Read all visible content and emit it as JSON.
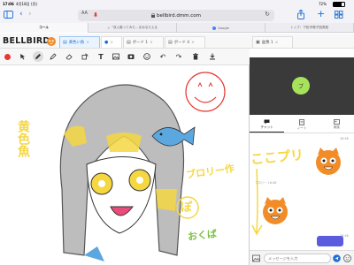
{
  "status_bar": {
    "time": "17:06",
    "date": "4月18日 (月)",
    "battery": "72%"
  },
  "browser": {
    "url": "bellbird.dmm.com",
    "tabs": [
      {
        "label": "コール",
        "active": true
      },
      {
        "label": "\"収入集ってみた…まねなたえる",
        "active": false
      },
      {
        "label": "Google",
        "active": false
      },
      {
        "label": "トップ：下松市電子図書館",
        "active": false
      }
    ]
  },
  "app": {
    "logo": "BELLBIRD",
    "tabs": [
      {
        "label": "黄色い魚",
        "active": true
      },
      {
        "label": "",
        "active": false,
        "kind": "user"
      },
      {
        "label": "ボード 1",
        "active": false
      },
      {
        "label": "ボード 4",
        "active": false
      }
    ],
    "side_tab": "画像 1"
  },
  "toolbar": {
    "tools": [
      "record-dot",
      "pointer",
      "pen",
      "marker",
      "eraser",
      "rotate",
      "text",
      "image",
      "photo",
      "emoji",
      "undo",
      "redo",
      "trash",
      "download"
    ]
  },
  "canvas": {
    "labels": {
      "yellow_fish": "黄色魚",
      "broccoli_made": "ブロリー作",
      "po": "ぽ",
      "okuba": "おくば",
      "kokopuri": "ここプリ"
    }
  },
  "side": {
    "avatar_letter": "ブ",
    "tabs": [
      {
        "label": "チャット",
        "icon": "chat-icon",
        "active": true
      },
      {
        "label": "ノート",
        "icon": "note-icon",
        "active": false
      },
      {
        "label": "家族",
        "icon": "family-icon",
        "active": false
      }
    ],
    "messages": [
      {
        "time": "16:46"
      },
      {
        "sender": "ブロリー",
        "time": "16:46"
      },
      {
        "time": "16:46"
      }
    ],
    "input_placeholder": "メッセージを入力"
  }
}
